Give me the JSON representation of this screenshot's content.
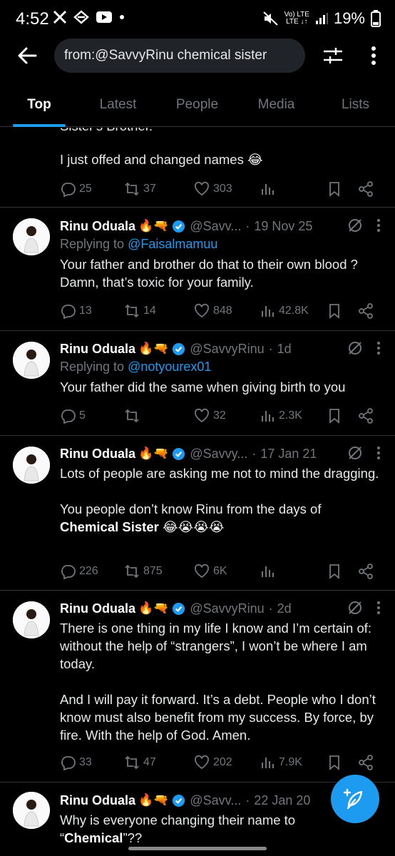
{
  "status_bar": {
    "time": "4:52",
    "battery": "19%",
    "volte_top": "Vo) LTE",
    "volte_bottom": "LTE ↓↑"
  },
  "header": {
    "search_query": "from:@SavvyRinu chemical sister"
  },
  "tabs": [
    {
      "label": "Top",
      "active": true
    },
    {
      "label": "Latest",
      "active": false
    },
    {
      "label": "People",
      "active": false
    },
    {
      "label": "Media",
      "active": false
    },
    {
      "label": "Lists",
      "active": false
    }
  ],
  "tweets": [
    {
      "cut_line": "Sister's Brother.",
      "text": "I just offed and changed names 😂",
      "replies": "25",
      "reposts": "37",
      "likes": "303",
      "views": ""
    },
    {
      "name": "Rinu Oduala",
      "emoji": "🔥🔫",
      "handle": "@Savv...",
      "date": "19 Nov 25",
      "replying_prefix": "Replying to ",
      "replying_to": "@Faisalmamuu",
      "text": "Your father and brother do that to their own blood ? Damn, that’s toxic for your family.",
      "replies": "13",
      "reposts": "14",
      "likes": "848",
      "views": "42.8K"
    },
    {
      "name": "Rinu Oduala",
      "emoji": "🔥🔫",
      "handle": "@SavvyRinu",
      "date": "1d",
      "replying_prefix": "Replying to ",
      "replying_to": "@notyourex01",
      "text": "Your father did the same when giving birth to you",
      "replies": "5",
      "reposts": "",
      "likes": "32",
      "views": "2.3K"
    },
    {
      "name": "Rinu Oduala",
      "emoji": "🔥🔫",
      "handle": "@Savvy...",
      "date": "17 Jan 21",
      "text_1": "Lots of people are asking me not to mind the dragging.\n\nYou people don’t know Rinu from the days of ",
      "text_bold": "Chemical Sister",
      "text_2": " 😂😭😭😭",
      "replies": "226",
      "reposts": "875",
      "likes": "6K",
      "views": ""
    },
    {
      "name": "Rinu Oduala",
      "emoji": "🔥🔫",
      "handle": "@SavvyRinu",
      "date": "2d",
      "text": "There is one thing in my life I know and I’m certain of: without the help of “strangers”, I won’t be where I am today.\n\nAnd I will pay it forward. It’s a debt. People who I don’t know must also benefit from my success. By force, by fire. With the help of God. Amen.",
      "replies": "33",
      "reposts": "47",
      "likes": "202",
      "views": "7.9K"
    },
    {
      "name": "Rinu Oduala",
      "emoji": "🔥🔫",
      "handle": "@Savv...",
      "date": "22 Jan 20",
      "text_1": "Why is everyone changing their name to\n“",
      "text_bold": "Chemical",
      "text_2": "”??"
    }
  ],
  "colors": {
    "accent": "#1d9bf0",
    "background": "#000000",
    "secondary_text": "#71767b"
  },
  "icons": [
    "back-arrow-icon",
    "filter-icon",
    "more-vertical-icon",
    "reply-icon",
    "repost-icon",
    "like-icon",
    "views-icon",
    "bookmark-icon",
    "share-icon",
    "grok-icon",
    "verified-icon",
    "compose-icon"
  ]
}
